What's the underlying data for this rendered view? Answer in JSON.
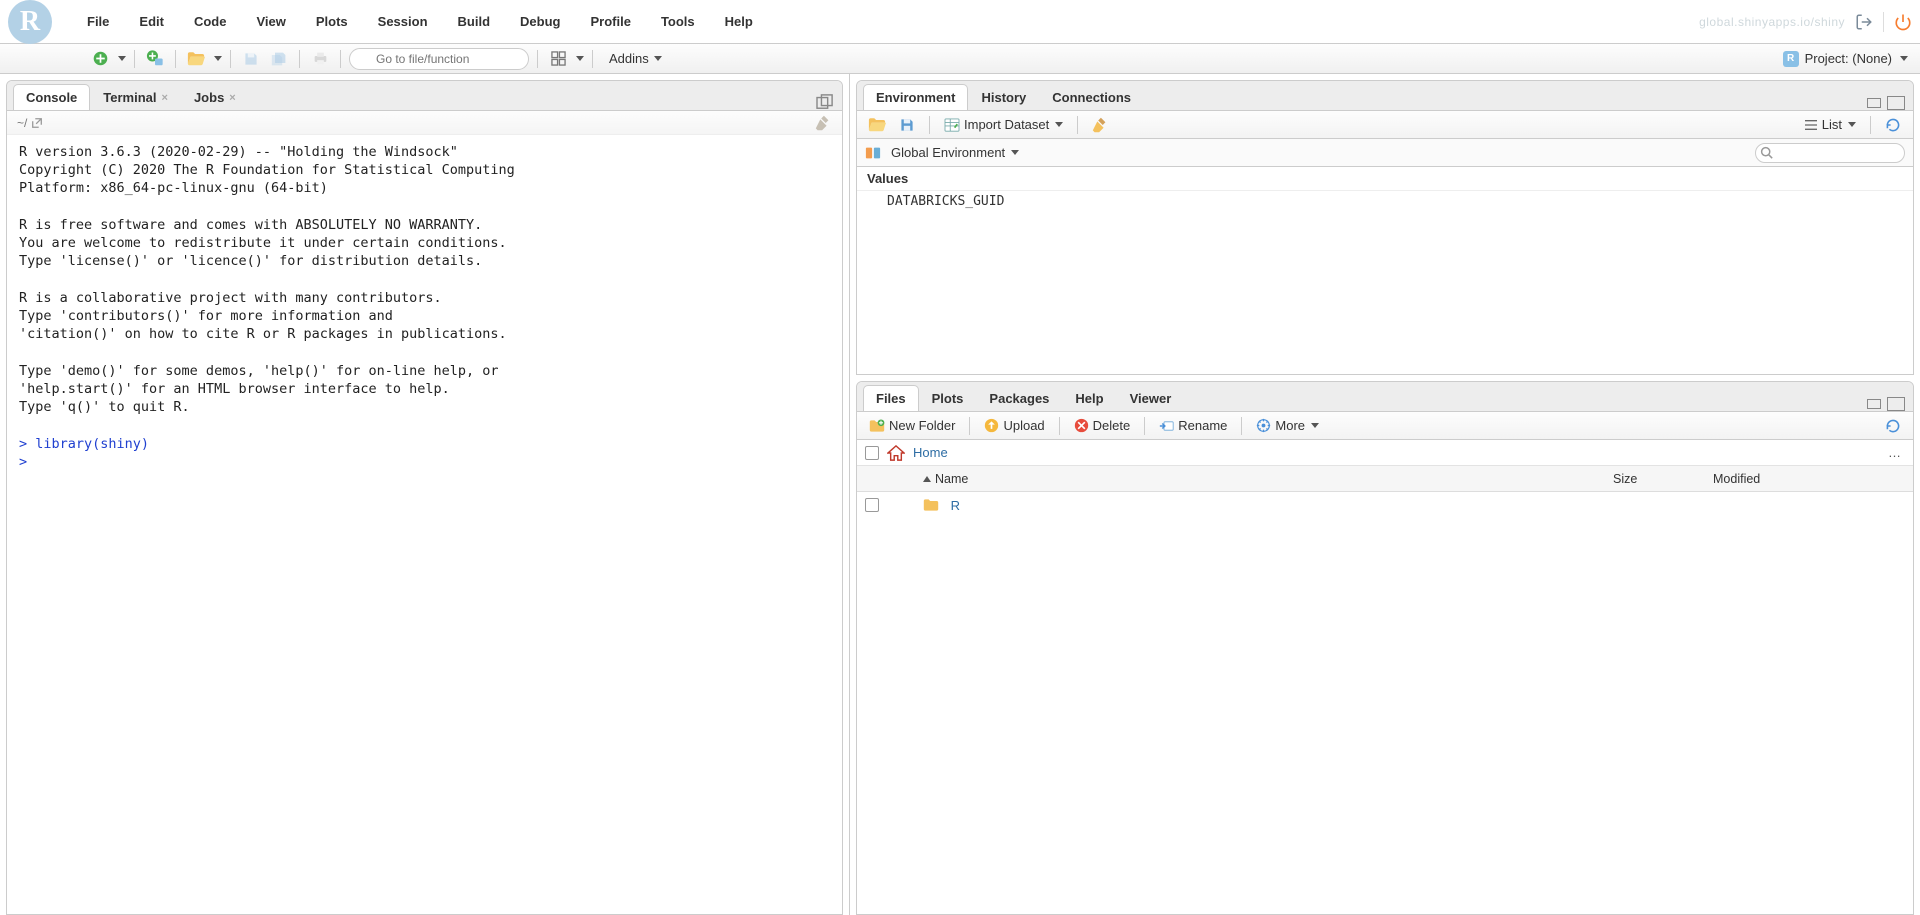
{
  "menubar": [
    "File",
    "Edit",
    "Code",
    "View",
    "Plots",
    "Session",
    "Build",
    "Debug",
    "Profile",
    "Tools",
    "Help"
  ],
  "menubar_right_link": "global.shinyapps.io/shiny",
  "toolbar": {
    "goto_placeholder": "Go to file/function",
    "addins_label": "Addins",
    "project_label": "Project: (None)"
  },
  "left_tabs": {
    "items": [
      "Console",
      "Terminal",
      "Jobs"
    ],
    "active": 0
  },
  "console": {
    "path": "~/",
    "startup": "R version 3.6.3 (2020-02-29) -- \"Holding the Windsock\"\nCopyright (C) 2020 The R Foundation for Statistical Computing\nPlatform: x86_64-pc-linux-gnu (64-bit)\n\nR is free software and comes with ABSOLUTELY NO WARRANTY.\nYou are welcome to redistribute it under certain conditions.\nType 'license()' or 'licence()' for distribution details.\n\nR is a collaborative project with many contributors.\nType 'contributors()' for more information and\n'citation()' on how to cite R or R packages in publications.\n\nType 'demo()' for some demos, 'help()' for on-line help, or\n'help.start()' for an HTML browser interface to help.\nType 'q()' to quit R.\n",
    "input_line": "> library(shiny)",
    "next_prompt": "> "
  },
  "env_pane": {
    "tabs": [
      "Environment",
      "History",
      "Connections"
    ],
    "active": 0,
    "toolbar": {
      "import_label": "Import Dataset",
      "view_label": "List"
    },
    "scope": "Global Environment",
    "section": "Values",
    "rows": [
      {
        "name": "DATABRICKS_GUID",
        "value": ""
      }
    ]
  },
  "files_pane": {
    "tabs": [
      "Files",
      "Plots",
      "Packages",
      "Help",
      "Viewer"
    ],
    "active": 0,
    "toolbar": {
      "new_folder": "New Folder",
      "upload": "Upload",
      "delete": "Delete",
      "rename": "Rename",
      "more": "More"
    },
    "breadcrumb": "Home",
    "columns": {
      "name": "Name",
      "size": "Size",
      "modified": "Modified"
    },
    "rows": [
      {
        "name": "R",
        "type": "folder"
      }
    ]
  }
}
